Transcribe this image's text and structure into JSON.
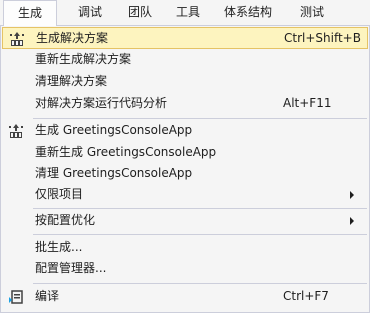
{
  "menubar": {
    "items": [
      {
        "label": "生成"
      },
      {
        "label": "调试"
      },
      {
        "label": "团队"
      },
      {
        "label": "工具"
      },
      {
        "label": "体系结构"
      },
      {
        "label": "测试"
      }
    ]
  },
  "menu": {
    "items": [
      {
        "label": "生成解决方案",
        "shortcut": "Ctrl+Shift+B",
        "icon": "build-icon",
        "highlighted": true
      },
      {
        "label": "重新生成解决方案",
        "shortcut": ""
      },
      {
        "label": "清理解决方案",
        "shortcut": ""
      },
      {
        "label": "对解决方案运行代码分析",
        "shortcut": "Alt+F11"
      },
      {
        "label": "生成 GreetingsConsoleApp",
        "shortcut": "",
        "icon": "build-icon"
      },
      {
        "label": "重新生成 GreetingsConsoleApp",
        "shortcut": ""
      },
      {
        "label": "清理 GreetingsConsoleApp",
        "shortcut": ""
      },
      {
        "label": "仅限项目",
        "shortcut": "",
        "submenu": true
      },
      {
        "label": "按配置优化",
        "shortcut": "",
        "submenu": true
      },
      {
        "label": "批生成...",
        "shortcut": ""
      },
      {
        "label": "配置管理器...",
        "shortcut": ""
      },
      {
        "label": "编译",
        "shortcut": "Ctrl+F7",
        "icon": "compile-icon"
      }
    ]
  },
  "colors": {
    "highlight_bg": "#fdf4bf",
    "highlight_border": "#e5c365",
    "menu_bg": "#f5f5f5",
    "separator": "#cccedb"
  }
}
